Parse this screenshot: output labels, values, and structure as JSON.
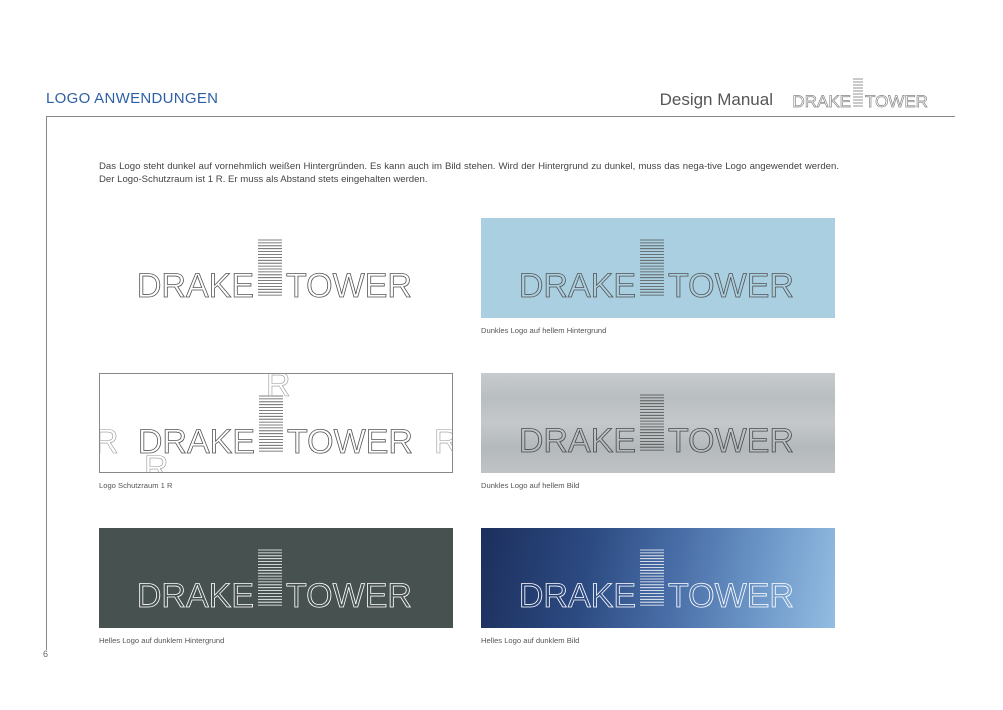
{
  "header": {
    "section_title": "LOGO ANWENDUNGEN",
    "manual_label": "Design Manual",
    "logo_word_left": "DRAKE",
    "logo_word_right": "TOWER"
  },
  "intro": "Das Logo steht dunkel auf vornehmlich weißen Hintergründen. Es kann auch im Bild stehen. Wird der Hintergrund zu dunkel, muss das nega-tive Logo angewendet werden. Der Logo-Schutzraum ist 1 R. Er muss als Abstand stets eingehalten werden.",
  "logo": {
    "left": "DRAKE",
    "right": "TOWER"
  },
  "panels": [
    {
      "caption": ""
    },
    {
      "caption": "Dunkles Logo auf hellem Hintergrund"
    },
    {
      "caption": "Logo Schutzraum 1 R",
      "spacing_letter": "R"
    },
    {
      "caption": "Dunkles Logo auf hellem Bild"
    },
    {
      "caption": "Helles Logo auf dunklem Hintergrund"
    },
    {
      "caption": "Helles Logo auf dunklem Bild"
    }
  ],
  "colors": {
    "accent": "#2d5fa6",
    "light_blue_background": "#a9cfe0",
    "dark_background": "#465150",
    "dark_logo": "#555555",
    "light_logo": "#ffffff"
  },
  "page_number": "6"
}
